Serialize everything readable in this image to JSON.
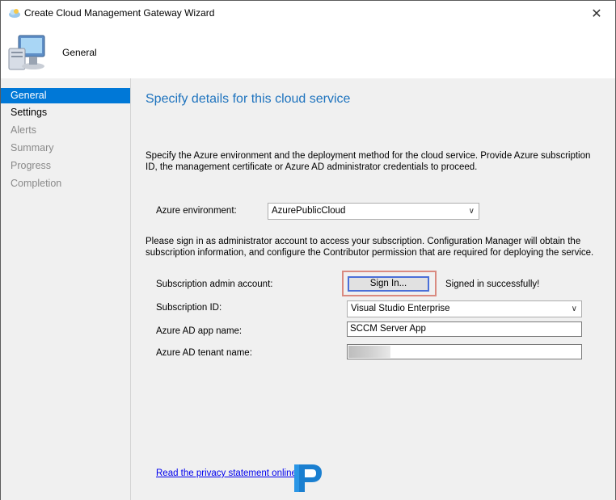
{
  "window": {
    "title": "Create Cloud Management Gateway Wizard",
    "close_glyph": "✕"
  },
  "header": {
    "title": "General"
  },
  "sidebar": {
    "items": [
      {
        "label": "General"
      },
      {
        "label": "Settings"
      },
      {
        "label": "Alerts"
      },
      {
        "label": "Summary"
      },
      {
        "label": "Progress"
      },
      {
        "label": "Completion"
      }
    ]
  },
  "main": {
    "page_title": "Specify details for this cloud service",
    "intro": "Specify the Azure environment and the deployment method for the cloud service. Provide Azure subscription ID, the management certificate or Azure AD administrator credentials to proceed.",
    "azure_environment": {
      "label": "Azure environment:",
      "value": "AzurePublicCloud"
    },
    "signin_note": "Please sign in as administrator account to access your subscription. Configuration Manager will obtain the subscription information, and configure the Contributor permission that are required for deploying the service.",
    "subscription_admin": {
      "label": "Subscription admin account:",
      "button": "Sign In...",
      "status": "Signed in successfully!"
    },
    "subscription_id": {
      "label": "Subscription ID:",
      "value": "Visual Studio Enterprise"
    },
    "app_name": {
      "label": "Azure AD app name:",
      "value": "SCCM Server App"
    },
    "tenant_name": {
      "label": "Azure AD tenant name:",
      "value": ""
    },
    "privacy_link": "Read the privacy statement online."
  },
  "colors": {
    "accent": "#0078d7",
    "title_blue": "#1e73be",
    "highlight": "#d98a80"
  },
  "icons": [
    "cloud-app-icon",
    "computer-icon",
    "close-icon",
    "chevron-down-icon",
    "watermark-logo"
  ]
}
